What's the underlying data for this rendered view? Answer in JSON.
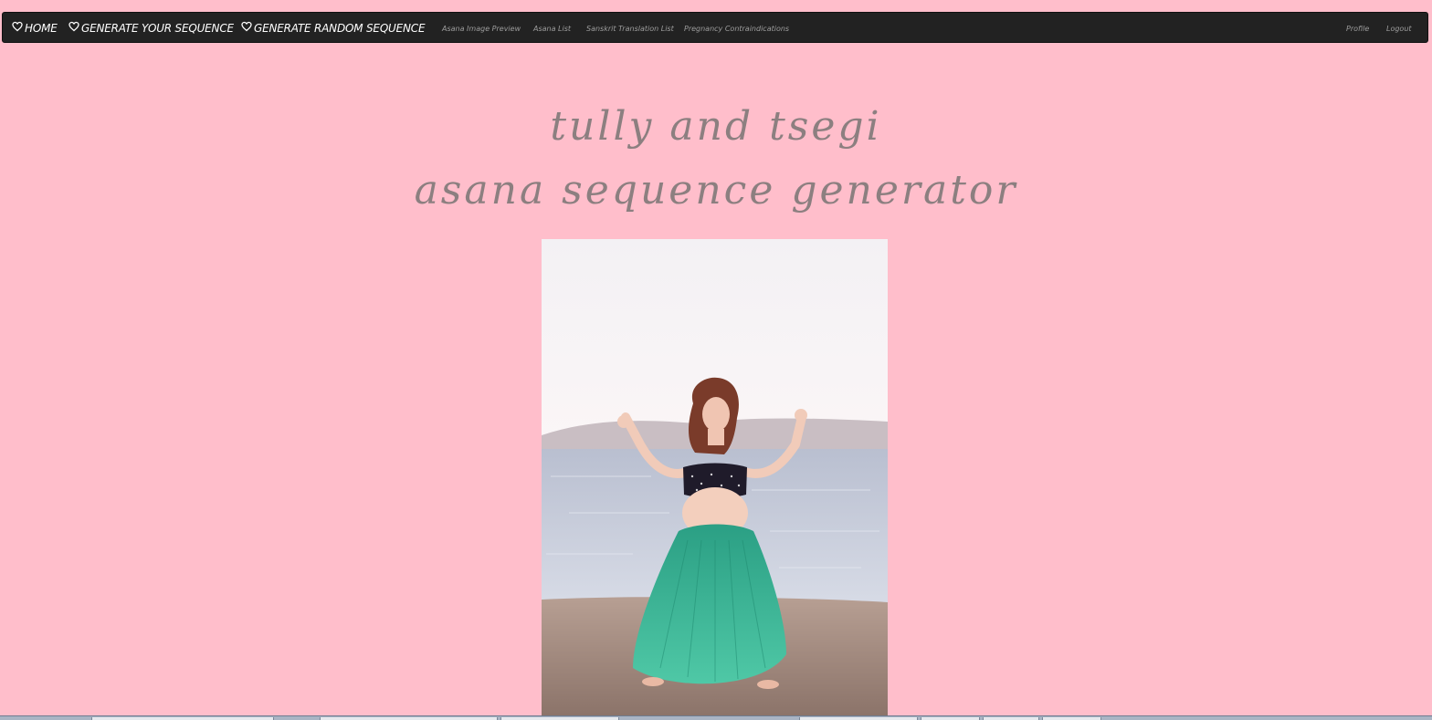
{
  "navbar": {
    "main_links": [
      {
        "label": "HOME",
        "icon": "heart-outline-icon"
      },
      {
        "label": "GENERATE YOUR SEQUENCE",
        "icon": "heart-outline-icon"
      },
      {
        "label": "GENERATE RANDOM SEQUENCE",
        "icon": "heart-outline-icon"
      }
    ],
    "secondary_links": [
      {
        "label": "Asana Image Preview"
      },
      {
        "label": "Asana List"
      },
      {
        "label": "Sanskrit Translation List"
      },
      {
        "label": "Pregnancy Contraindications"
      }
    ],
    "right_links": [
      {
        "label": "Profile"
      },
      {
        "label": "Logout"
      }
    ]
  },
  "header": {
    "title_line1": "tully and tsegi",
    "title_line2": "asana sequence generator"
  },
  "colors": {
    "background": "#ffbecb",
    "navbar": "#222222",
    "title": "#8c7f80",
    "nav_main_text": "#ffffff",
    "nav_secondary_text": "#9d9d9d"
  }
}
